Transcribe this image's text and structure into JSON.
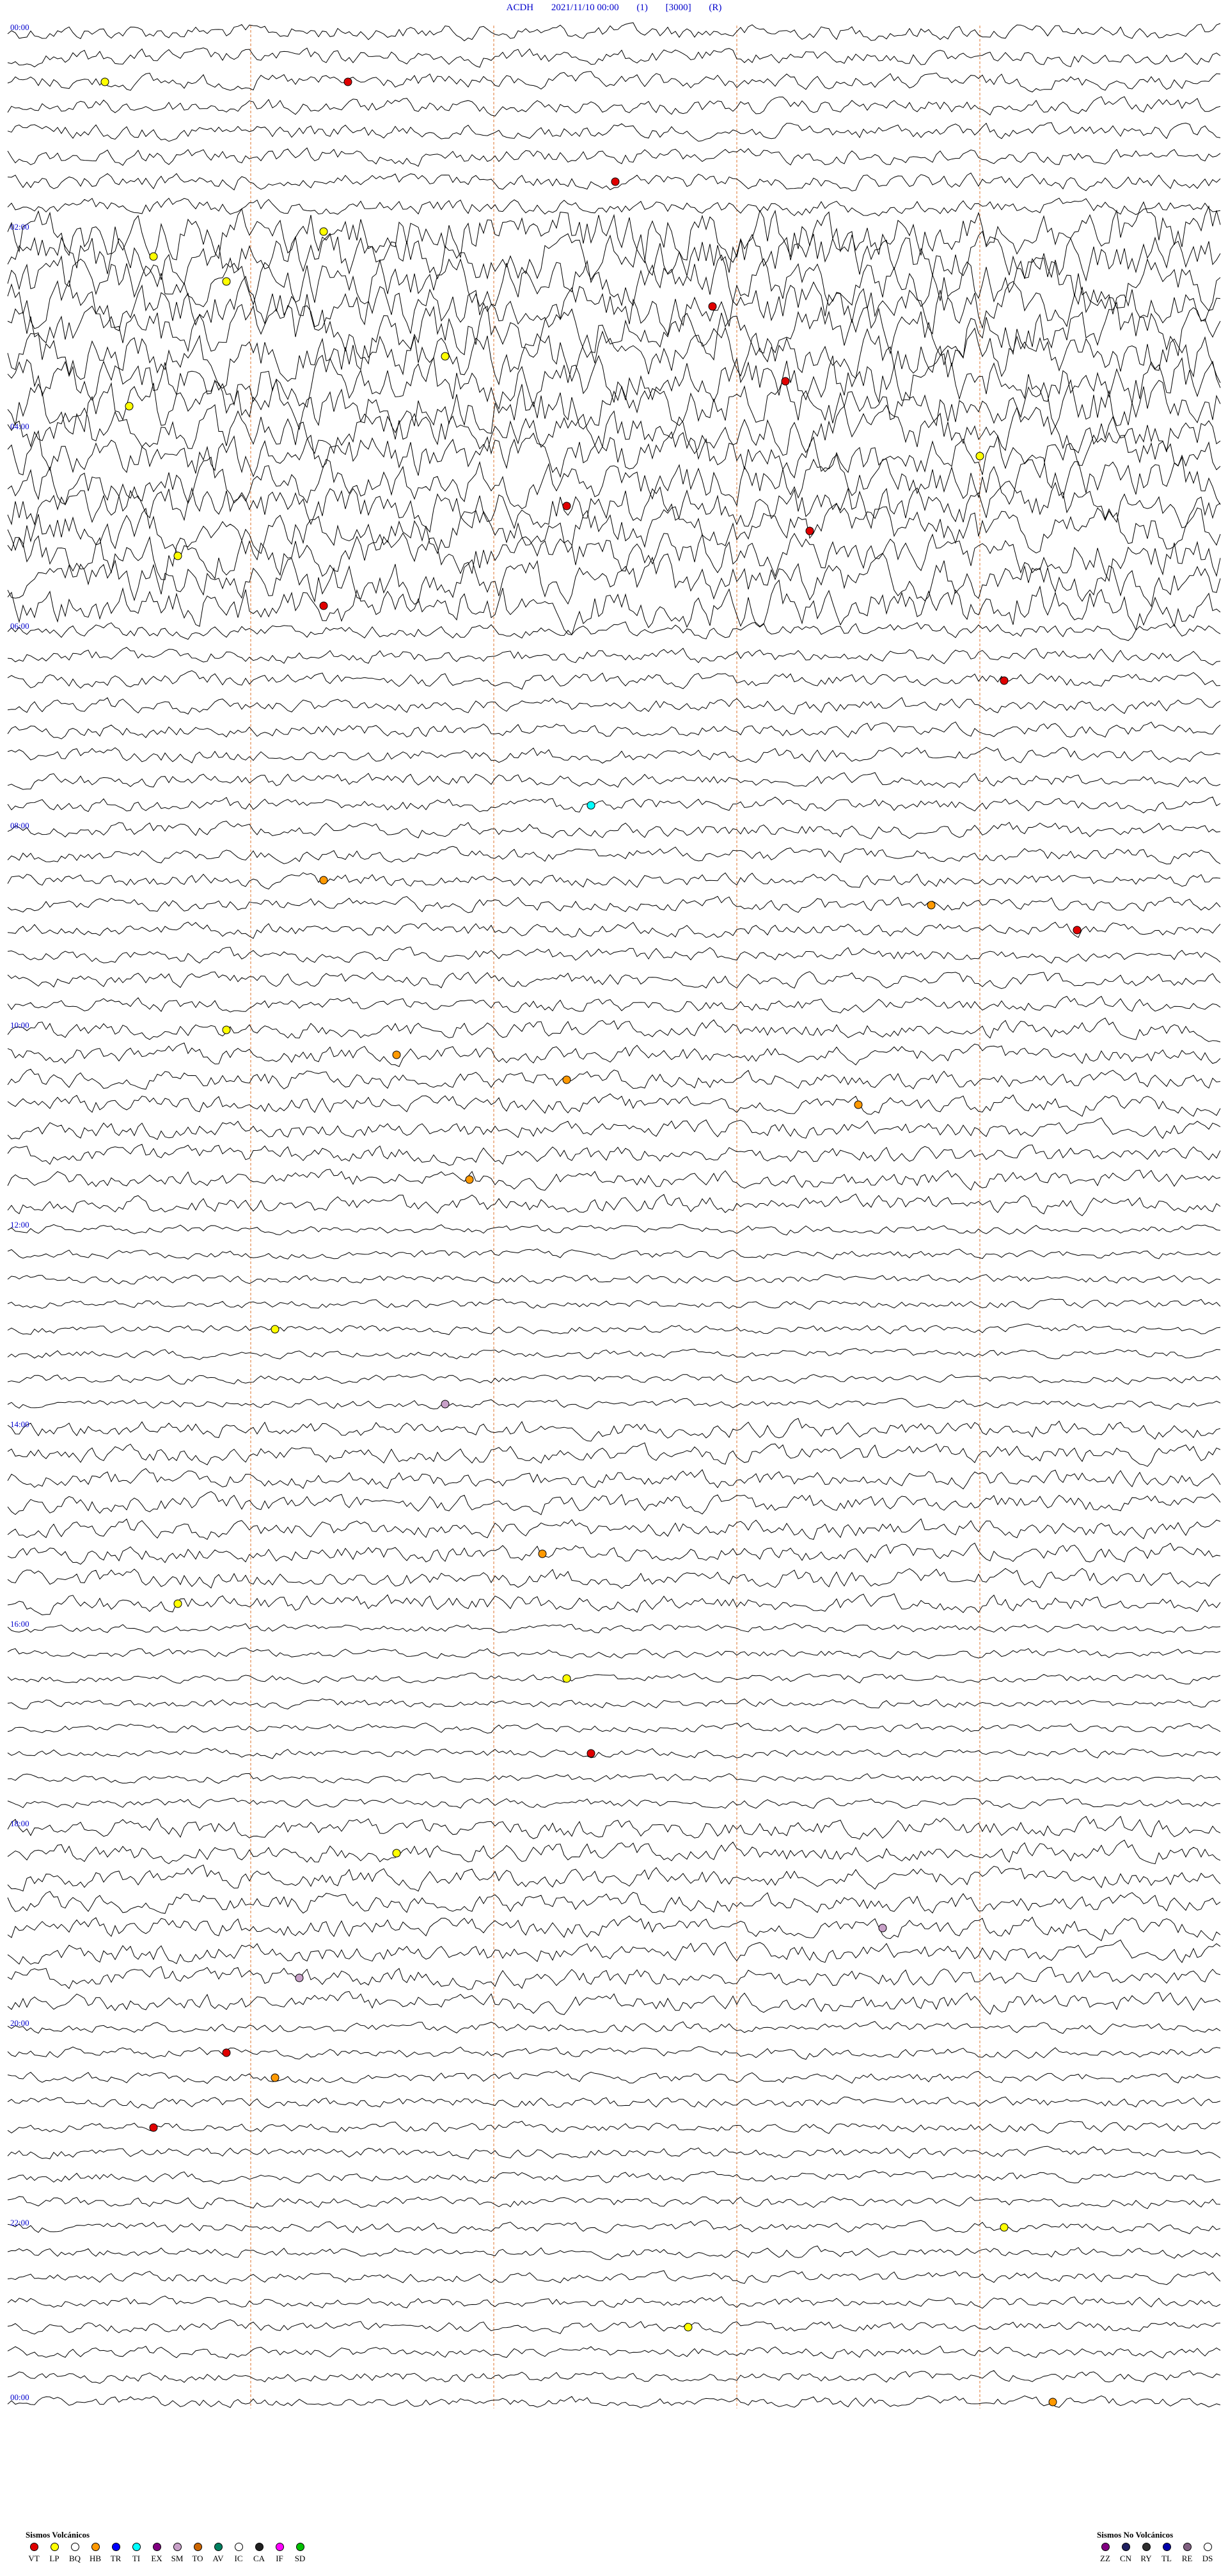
{
  "header": {
    "station": "ACDH",
    "datetime": "2021/11/10 00:00",
    "channel": "(1)",
    "scale": "[3000]",
    "mode": "(R)"
  },
  "chart_data": {
    "type": "line",
    "title": "ACDH 2021/11/10 00:00 (1) [3000] (R)",
    "xlabel": "",
    "ylabel": "",
    "row_minutes": 15,
    "row_count": 96,
    "y_tick_labels": [
      "00:00",
      "02:00",
      "04:00",
      "06:00",
      "08:00",
      "10:00",
      "12:00",
      "14:00",
      "16:00",
      "18:00",
      "20:00",
      "22:00",
      "00:00"
    ],
    "noise_bands": [
      {
        "from_row": 0,
        "to_row": 8,
        "amplitude": 0.9
      },
      {
        "from_row": 8,
        "to_row": 16,
        "amplitude": 2.8
      },
      {
        "from_row": 16,
        "to_row": 24,
        "amplitude": 2.4
      },
      {
        "from_row": 24,
        "to_row": 40,
        "amplitude": 0.8
      },
      {
        "from_row": 40,
        "to_row": 48,
        "amplitude": 1.0
      },
      {
        "from_row": 48,
        "to_row": 56,
        "amplitude": 0.5
      },
      {
        "from_row": 56,
        "to_row": 64,
        "amplitude": 1.0
      },
      {
        "from_row": 64,
        "to_row": 72,
        "amplitude": 0.5
      },
      {
        "from_row": 72,
        "to_row": 80,
        "amplitude": 1.1
      },
      {
        "from_row": 80,
        "to_row": 96,
        "amplitude": 0.6
      }
    ],
    "minute_markers": [
      10,
      20,
      30,
      40
    ],
    "events": [
      {
        "row": 2,
        "minute": 4,
        "type": "LP"
      },
      {
        "row": 2,
        "minute": 14,
        "type": "VT"
      },
      {
        "row": 6,
        "minute": 25,
        "type": "VT"
      },
      {
        "row": 8,
        "minute": 13,
        "type": "LP"
      },
      {
        "row": 9,
        "minute": 6,
        "type": "LP"
      },
      {
        "row": 10,
        "minute": 9,
        "type": "LP"
      },
      {
        "row": 11,
        "minute": 29,
        "type": "VT"
      },
      {
        "row": 13,
        "minute": 18,
        "type": "LP"
      },
      {
        "row": 14,
        "minute": 32,
        "type": "VT"
      },
      {
        "row": 15,
        "minute": 5,
        "type": "LP"
      },
      {
        "row": 17,
        "minute": 40,
        "type": "LP"
      },
      {
        "row": 19,
        "minute": 23,
        "type": "VT"
      },
      {
        "row": 20,
        "minute": 33,
        "type": "VT"
      },
      {
        "row": 21,
        "minute": 7,
        "type": "LP"
      },
      {
        "row": 23,
        "minute": 13,
        "type": "VT"
      },
      {
        "row": 26,
        "minute": 41,
        "type": "VT"
      },
      {
        "row": 31,
        "minute": 24,
        "type": "TI"
      },
      {
        "row": 34,
        "minute": 13,
        "type": "HB"
      },
      {
        "row": 35,
        "minute": 38,
        "type": "HB"
      },
      {
        "row": 36,
        "minute": 44,
        "type": "VT"
      },
      {
        "row": 40,
        "minute": 9,
        "type": "LP"
      },
      {
        "row": 41,
        "minute": 16,
        "type": "HB"
      },
      {
        "row": 42,
        "minute": 23,
        "type": "HB"
      },
      {
        "row": 43,
        "minute": 35,
        "type": "HB"
      },
      {
        "row": 46,
        "minute": 19,
        "type": "HB"
      },
      {
        "row": 52,
        "minute": 11,
        "type": "LP"
      },
      {
        "row": 55,
        "minute": 18,
        "type": "SM"
      },
      {
        "row": 61,
        "minute": 22,
        "type": "HB"
      },
      {
        "row": 63,
        "minute": 7,
        "type": "LP"
      },
      {
        "row": 66,
        "minute": 23,
        "type": "LP"
      },
      {
        "row": 69,
        "minute": 24,
        "type": "VT"
      },
      {
        "row": 73,
        "minute": 16,
        "type": "LP"
      },
      {
        "row": 76,
        "minute": 36,
        "type": "SM"
      },
      {
        "row": 78,
        "minute": 12,
        "type": "SM"
      },
      {
        "row": 81,
        "minute": 9,
        "type": "VT"
      },
      {
        "row": 82,
        "minute": 11,
        "type": "HB"
      },
      {
        "row": 84,
        "minute": 6,
        "type": "VT"
      },
      {
        "row": 88,
        "minute": 41,
        "type": "LP"
      },
      {
        "row": 92,
        "minute": 28,
        "type": "LP"
      },
      {
        "row": 95,
        "minute": 43,
        "type": "HB"
      }
    ]
  },
  "legend_volcanic": {
    "title": "Sismos Volcánicos",
    "items": [
      {
        "code": "VT",
        "color": "#e00000"
      },
      {
        "code": "LP",
        "color": "#ffff00"
      },
      {
        "code": "BQ",
        "color": "#ffffff"
      },
      {
        "code": "HB",
        "color": "#ff9900"
      },
      {
        "code": "TR",
        "color": "#0000ff"
      },
      {
        "code": "TI",
        "color": "#00ffff"
      },
      {
        "code": "EX",
        "color": "#800080"
      },
      {
        "code": "SM",
        "color": "#c8a0c8"
      },
      {
        "code": "TO",
        "color": "#cc6600"
      },
      {
        "code": "AV",
        "color": "#008060"
      },
      {
        "code": "IC",
        "color": "#ffffff"
      },
      {
        "code": "CA",
        "color": "#202020"
      },
      {
        "code": "IF",
        "color": "#ff00ff"
      },
      {
        "code": "SD",
        "color": "#00c000"
      }
    ]
  },
  "legend_nonvolcanic": {
    "title": "Sismos No Volcánicos",
    "items": [
      {
        "code": "ZZ",
        "color": "#800080"
      },
      {
        "code": "CN",
        "color": "#202060"
      },
      {
        "code": "RY",
        "color": "#303030"
      },
      {
        "code": "TL",
        "color": "#0000aa"
      },
      {
        "code": "RE",
        "color": "#806080"
      },
      {
        "code": "DS",
        "color": "#ffffff"
      }
    ]
  }
}
